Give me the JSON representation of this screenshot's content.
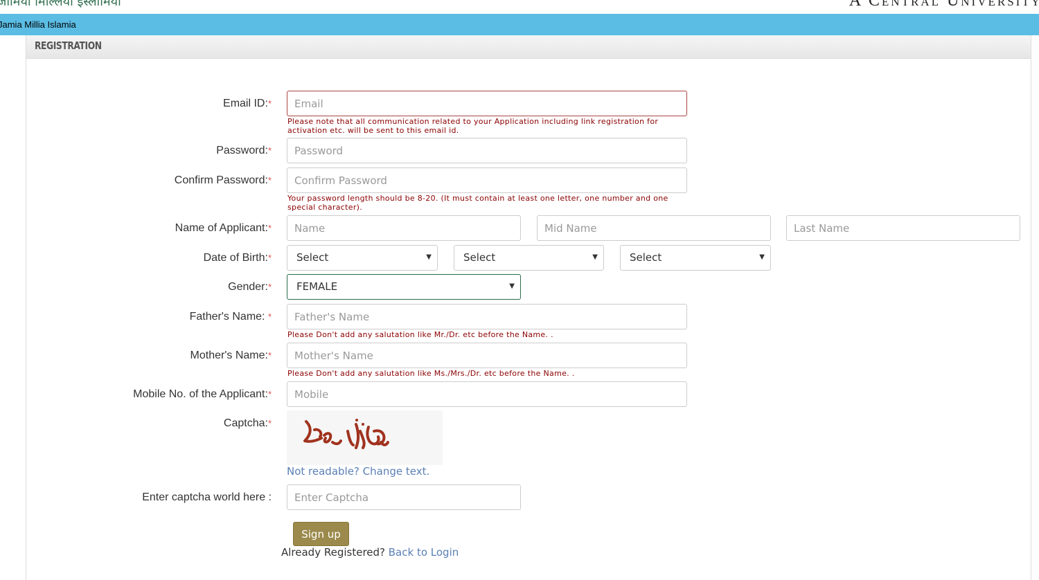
{
  "header": {
    "logo_text": "जामिया मिल्लिया इस्लामिया",
    "tagline": "A Central University",
    "nav_title": "Jamia Millia Islamia"
  },
  "panel": {
    "title": "REGISTRATION"
  },
  "form": {
    "required_mark": "*",
    "email": {
      "label": "Email ID:",
      "placeholder": "Email",
      "hint": "Please note that all communication related to your Application including link registration for activation etc. will be sent to this email id."
    },
    "password": {
      "label": "Password:",
      "placeholder": "Password"
    },
    "confirm_password": {
      "label": "Confirm Password:",
      "placeholder": "Confirm Password",
      "hint": "Your password length should be 8-20. (It must contain at least one letter, one number and one special character)."
    },
    "name": {
      "label": "Name of Applicant:",
      "first_placeholder": "Name",
      "mid_placeholder": "Mid Name",
      "last_placeholder": "Last Name"
    },
    "dob": {
      "label": "Date of Birth:",
      "day": "Select",
      "month": "Select",
      "year": "Select"
    },
    "gender": {
      "label": "Gender:",
      "value": "FEMALE"
    },
    "father": {
      "label": "Father's Name: ",
      "placeholder": "Father's Name",
      "hint": "Please Don't add any salutation like Mr./Dr. etc before the Name. ."
    },
    "mother": {
      "label": "Mother's Name:",
      "placeholder": "Mother's Name",
      "hint": "Please Don't add any salutation like Ms./Mrs./Dr. etc before the Name. ."
    },
    "mobile": {
      "label": "Mobile No. of the Applicant:",
      "placeholder": "Mobile"
    },
    "captcha": {
      "label": "Captcha:",
      "image_text": "clavija",
      "change_link": "Not readable? Change text."
    },
    "captcha_entry": {
      "label": "Enter captcha world here :",
      "placeholder": "Enter Captcha"
    },
    "signup_button": "Sign up",
    "already_registered": "Already Registered? ",
    "back_to_login": "Back to Login"
  },
  "colors": {
    "navbar": "#5bbde4",
    "hint_text": "#8b0000",
    "required": "#d9534f",
    "link": "#5a7fb5",
    "button": "#9b8a4b",
    "captcha_text": "#a0321e"
  },
  "icons": [
    "chevron-down-icon"
  ]
}
